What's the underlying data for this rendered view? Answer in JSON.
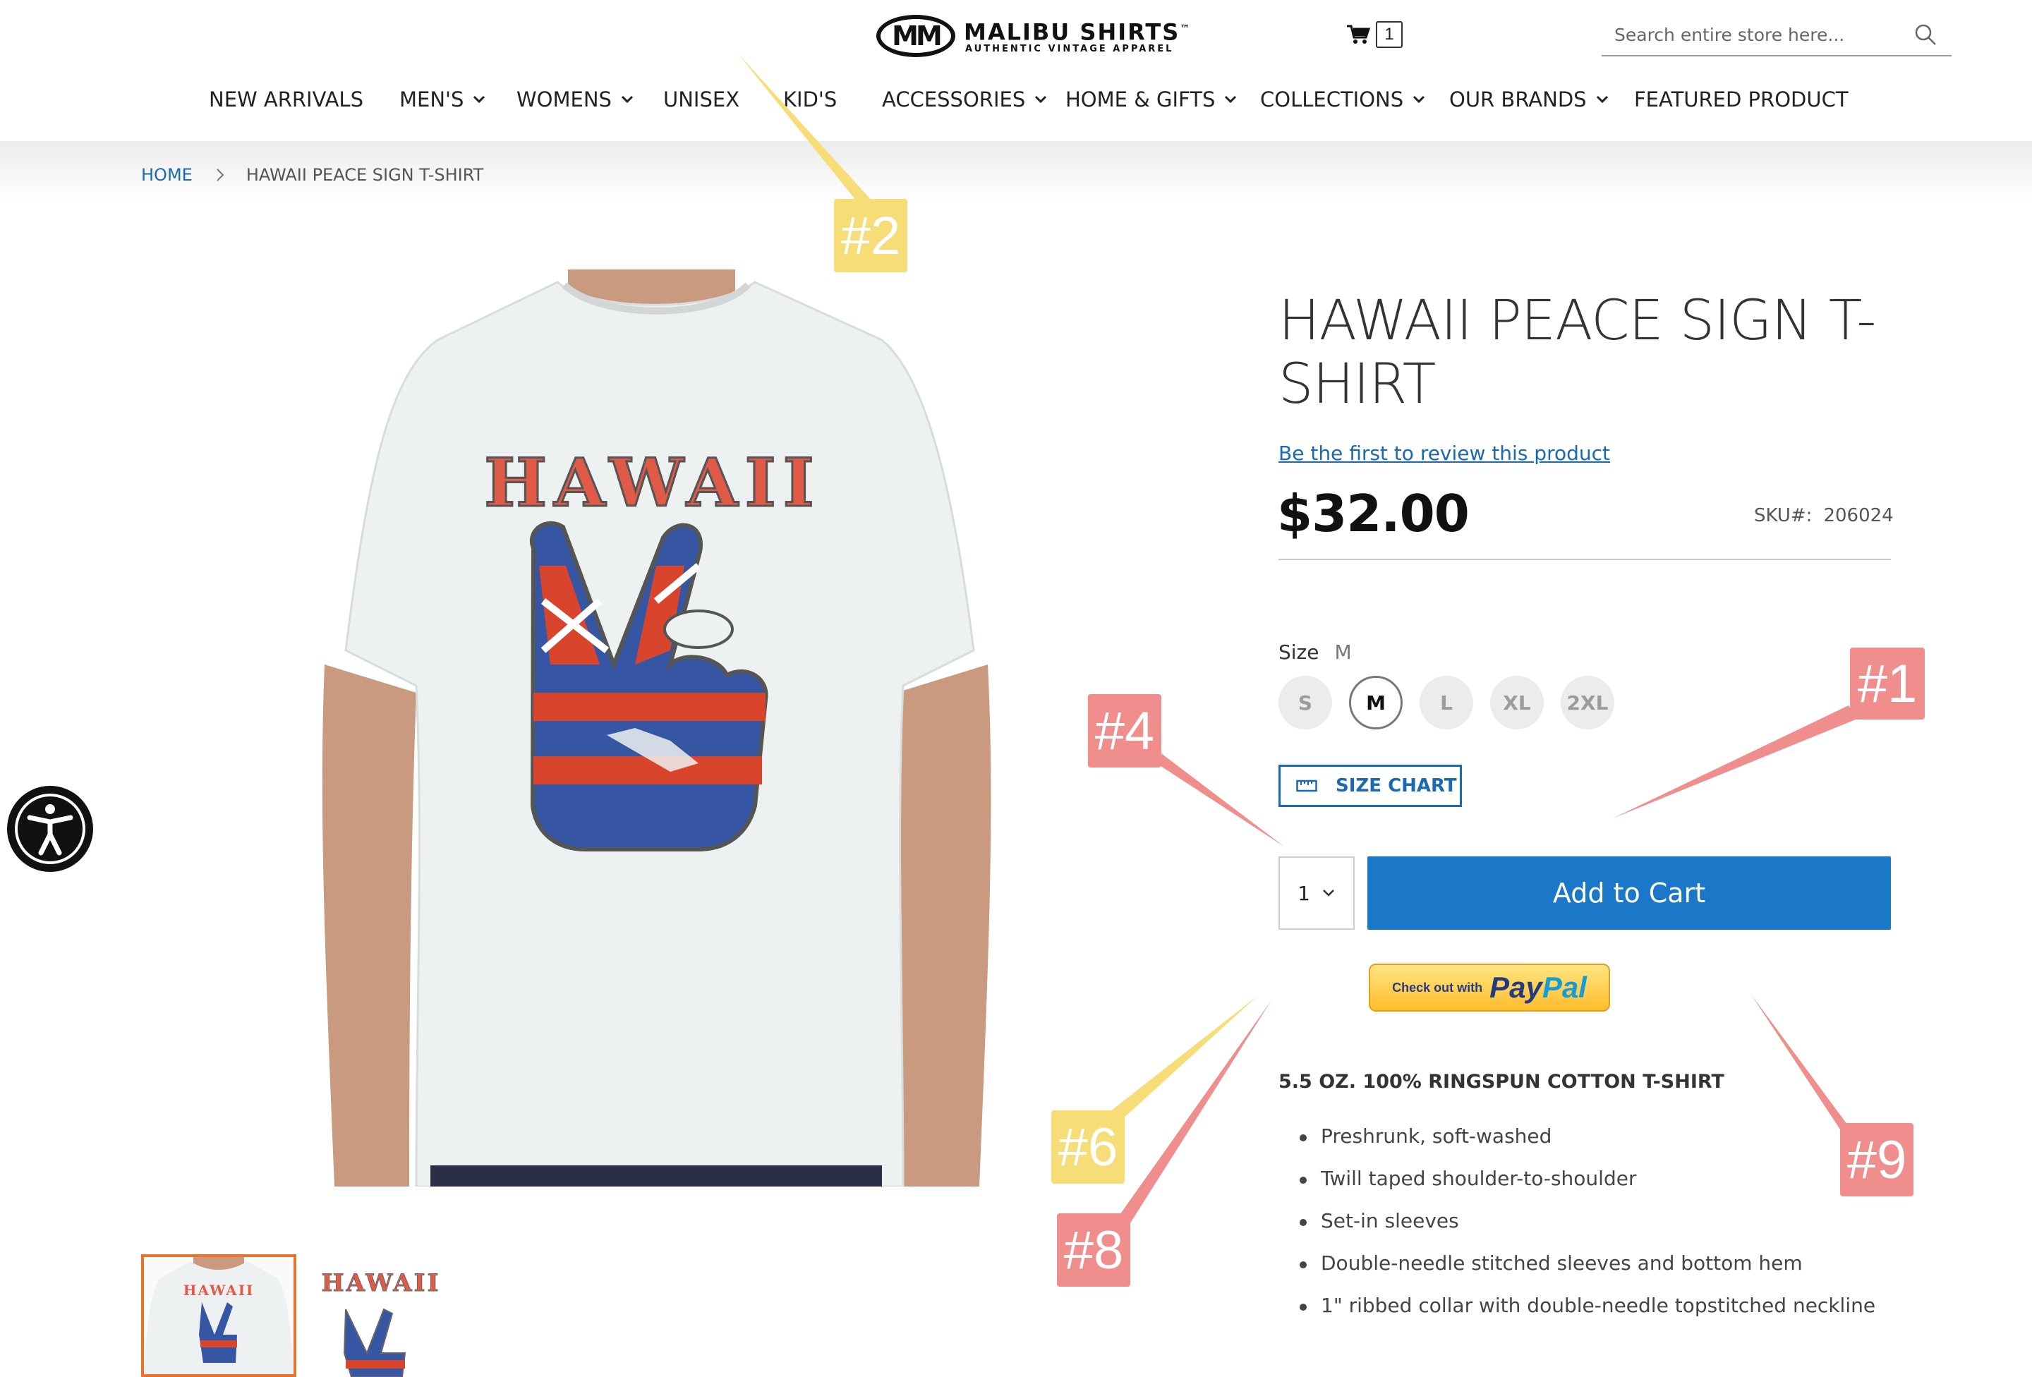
{
  "header": {
    "logo_title": "MALIBU SHIRTS",
    "logo_tm": "™",
    "logo_subtitle": "AUTHENTIC VINTAGE APPAREL",
    "cart_count": "1",
    "search_placeholder": "Search entire store here..."
  },
  "nav": {
    "items": [
      {
        "label": "NEW ARRIVALS",
        "dropdown": false
      },
      {
        "label": "MEN'S",
        "dropdown": true
      },
      {
        "label": "WOMENS",
        "dropdown": true
      },
      {
        "label": "UNISEX",
        "dropdown": false
      },
      {
        "label": "KID'S",
        "dropdown": false
      },
      {
        "label": "ACCESSORIES",
        "dropdown": true
      },
      {
        "label": "HOME & GIFTS",
        "dropdown": true
      },
      {
        "label": "COLLECTIONS",
        "dropdown": true
      },
      {
        "label": "OUR BRANDS",
        "dropdown": true
      },
      {
        "label": "FEATURED PRODUCT",
        "dropdown": false
      }
    ]
  },
  "breadcrumb": {
    "home": "HOME",
    "current": "HAWAII PEACE SIGN T-SHIRT"
  },
  "gallery": {
    "shirt_print_text": "HAWAII",
    "thumb_text": "HAWAII",
    "colors": {
      "shirt": "#eef1f1",
      "skin": "#c99a80",
      "flag_red": "#d9452c",
      "flag_blue": "#3656a3"
    }
  },
  "product": {
    "title": "HAWAII PEACE SIGN T-SHIRT",
    "review_link": "Be the first to review this product",
    "price": "$32.00",
    "sku_label": "SKU#:",
    "sku_value": "206024",
    "size_label": "Size",
    "size_selected": "M",
    "sizes": [
      "S",
      "M",
      "L",
      "XL",
      "2XL"
    ],
    "size_chart_label": "SIZE CHART",
    "quantity": "1",
    "add_to_cart_label": "Add to Cart",
    "paypal_prefix": "Check out with",
    "paypal_pay": "Pay",
    "paypal_pal": "Pal",
    "description_heading": "5.5 OZ. 100% RINGSPUN COTTON T-SHIRT",
    "features": [
      "Preshrunk, soft-washed",
      "Twill taped shoulder-to-shoulder",
      "Set-in sleeves",
      "Double-needle stitched sleeves and bottom hem",
      "1\" ribbed collar with double-needle topstitched neckline"
    ]
  },
  "annotations": [
    {
      "label": "#1",
      "color": "#f08e8e"
    },
    {
      "label": "#2",
      "color": "#f6dd78"
    },
    {
      "label": "#4",
      "color": "#f08e8e"
    },
    {
      "label": "#6",
      "color": "#f6dd78"
    },
    {
      "label": "#8",
      "color": "#f08e8e"
    },
    {
      "label": "#9",
      "color": "#f08e8e"
    }
  ],
  "colors": {
    "accent_blue": "#1b78c9",
    "link_blue": "#1a6ab3",
    "thumb_active": "#e8732c"
  }
}
